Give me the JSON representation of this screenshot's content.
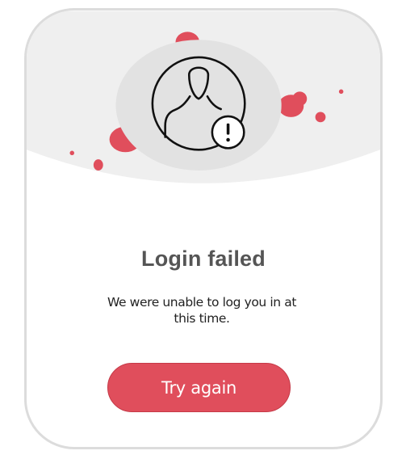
{
  "dialog": {
    "title": "Login failed",
    "message": "We were unable to log you in at this time.",
    "primary_button_label": "Try again"
  },
  "colors": {
    "accent": "#e04e5c",
    "header_bg": "#efefef",
    "avatar_circle": "#e2e2e2",
    "title_text": "#555555",
    "body_text": "#222222"
  },
  "icons": {
    "user_alert": "user-alert-icon",
    "warning": "exclamation-badge-icon"
  }
}
